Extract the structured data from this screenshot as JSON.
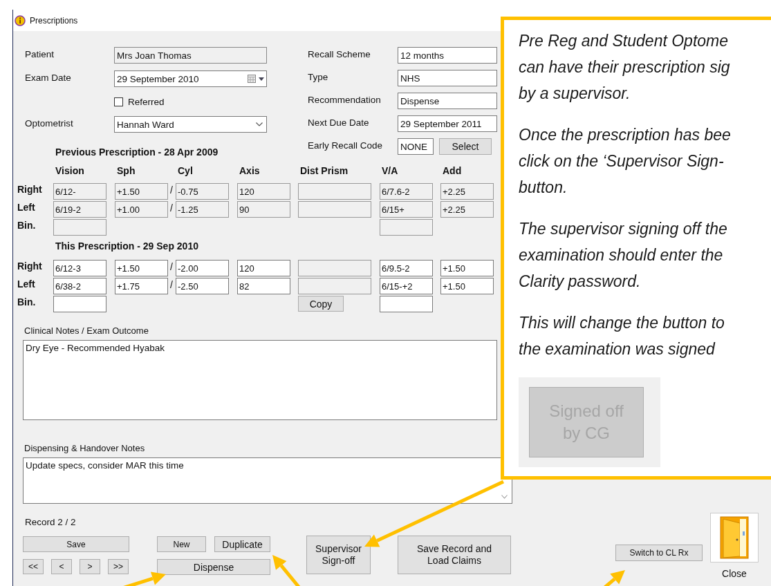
{
  "window": {
    "title": "Prescriptions"
  },
  "details_left": [
    {
      "label": "Patient",
      "value": "Mrs Joan Thomas",
      "kind": "readonly"
    },
    {
      "label": "Exam Date",
      "value": "29 September 2010",
      "kind": "date"
    },
    {
      "label": "Referred",
      "kind": "checkbox",
      "checked": false
    },
    {
      "label": "Optometrist",
      "value": "Hannah Ward",
      "kind": "dropdown"
    }
  ],
  "details_right": [
    {
      "label": "Recall Scheme",
      "value": "12 months",
      "kind": "text"
    },
    {
      "label": "Type",
      "value": "NHS",
      "kind": "text"
    },
    {
      "label": "Recommendation",
      "value": "Dispense",
      "kind": "text"
    },
    {
      "label": "Next Due Date",
      "value": "29 September 2011",
      "kind": "text"
    },
    {
      "label": "Early Recall Code",
      "value": "NONE",
      "button": "Select",
      "kind": "code"
    }
  ],
  "prescriptions": [
    {
      "title": "Previous Prescription - 28 Apr 2009",
      "columns": [
        "Vision",
        "Sph",
        "Cyl",
        "Axis",
        "Dist Prism",
        "V/A",
        "Add"
      ],
      "rows": [
        {
          "label": "Right",
          "separator": "/",
          "vision": {
            "value": "6/12-",
            "disabled": true
          },
          "sph": {
            "value": "+1.50",
            "disabled": true
          },
          "cyl": {
            "value": "-0.75",
            "disabled": true
          },
          "axis": {
            "value": "120",
            "disabled": true
          },
          "dist_prism": {
            "disabled": true
          },
          "va": {
            "value": "6/7.6-2",
            "disabled": true
          },
          "add": {
            "value": "+2.25",
            "disabled": true
          }
        },
        {
          "label": "Left",
          "separator": "/",
          "vision": {
            "value": "6/19-2",
            "disabled": true
          },
          "sph": {
            "value": "+1.00",
            "disabled": true
          },
          "cyl": {
            "value": "-1.25",
            "disabled": true
          },
          "axis": {
            "value": "90",
            "disabled": true
          },
          "dist_prism": {
            "disabled": true
          },
          "va": {
            "value": "6/15+",
            "disabled": true
          },
          "add": {
            "value": "+2.25",
            "disabled": true
          }
        },
        {
          "label": "Bin.",
          "vision": {
            "disabled": true
          },
          "va": {
            "disabled": true
          }
        }
      ]
    },
    {
      "title": "This Prescription - 29 Sep 2010",
      "copy_button": "Copy",
      "rows": [
        {
          "label": "Right",
          "separator": "/",
          "vision": {
            "value": "6/12-3",
            "disabled": false
          },
          "sph": {
            "value": "+1.50",
            "disabled": false
          },
          "cyl": {
            "value": "-2.00",
            "disabled": false
          },
          "axis": {
            "value": "120",
            "disabled": false
          },
          "dist_prism": {
            "disabled": true
          },
          "va": {
            "value": "6/9.5-2",
            "disabled": false
          },
          "add": {
            "value": "+1.50",
            "disabled": false
          }
        },
        {
          "label": "Left",
          "separator": "/",
          "vision": {
            "value": "6/38-2",
            "disabled": false
          },
          "sph": {
            "value": "+1.75",
            "disabled": false
          },
          "cyl": {
            "value": "-2.50",
            "disabled": false
          },
          "axis": {
            "value": "82",
            "disabled": false
          },
          "dist_prism": {
            "disabled": true
          },
          "va": {
            "value": "6/15-+2",
            "disabled": false
          },
          "add": {
            "value": "+1.50",
            "disabled": false
          }
        },
        {
          "label": "Bin.",
          "vision": {
            "disabled": false
          },
          "va": {
            "disabled": false
          }
        }
      ]
    }
  ],
  "clinical_notes": {
    "label": "Clinical Notes / Exam Outcome",
    "value": "Dry Eye - Recommended Hyabak"
  },
  "dispensing_notes": {
    "label": "Dispensing & Handover Notes",
    "value": "Update specs, consider MAR this time"
  },
  "record": "Record 2 / 2",
  "record_buttons": {
    "save": "Save",
    "new": "New",
    "duplicate": "Duplicate",
    "navigation": [
      "<<",
      "<",
      ">",
      ">>"
    ],
    "dispense": "Dispense"
  },
  "supervisor_button": "Supervisor Sign-off",
  "claims_button": "Save Record and Load Claims",
  "switch_button": "Switch to CL Rx",
  "close_button": "Close",
  "callout": {
    "paragraphs": [
      [
        "Pre Reg and Student Optome",
        "can have their prescription sig",
        "by a supervisor."
      ],
      [
        "Once the prescription has bee",
        "click on the ‘Supervisor Sign-",
        "button."
      ],
      [
        "The supervisor signing off the",
        "examination should enter the",
        "Clarity password."
      ],
      [
        "This will change the button to",
        "the examination was signed"
      ]
    ],
    "example_button": {
      "label": "Signed off by CG",
      "disabled": true
    }
  }
}
